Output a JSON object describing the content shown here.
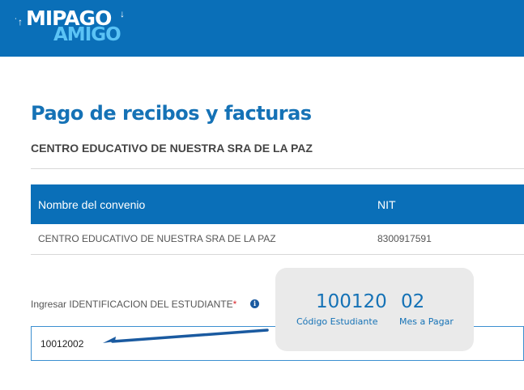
{
  "header": {
    "logo_line1": "MIPAGO",
    "logo_line2": "AMIGO",
    "brand_color": "#0a6fb8"
  },
  "page": {
    "title": "Pago de recibos y facturas",
    "subtitle": "CENTRO EDUCATIVO DE NUESTRA SRA DE LA PAZ"
  },
  "table": {
    "columns": [
      "Nombre del convenio",
      "NIT"
    ],
    "rows": [
      [
        "CENTRO EDUCATIVO DE NUESTRA SRA DE LA PAZ",
        "8300917591"
      ]
    ]
  },
  "form": {
    "label": "Ingresar IDENTIFICACION DEL ESTUDIANTE",
    "required_mark": "*",
    "value": "10012002"
  },
  "tooltip": {
    "code_value": "100120",
    "code_caption": "Código Estudiante",
    "month_value": "02",
    "month_caption": "Mes a Pagar"
  }
}
